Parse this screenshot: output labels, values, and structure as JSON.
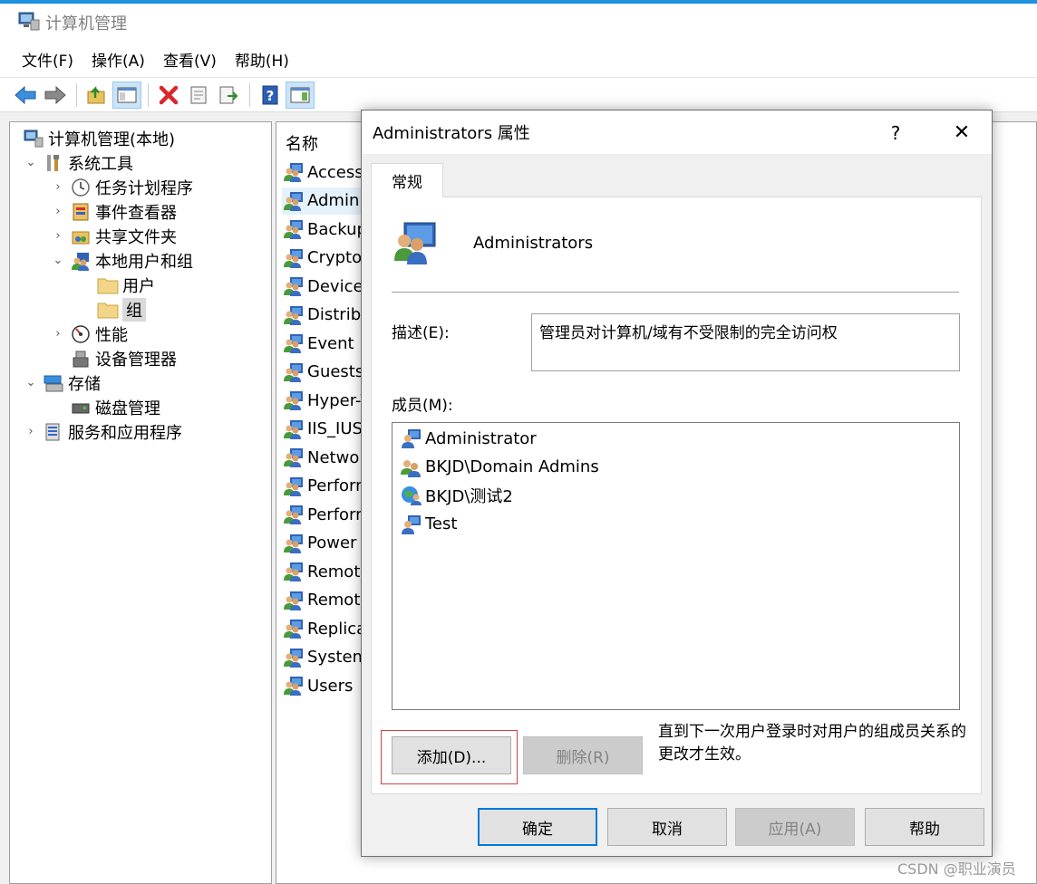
{
  "window": {
    "title": "计算机管理",
    "menu": [
      "文件(F)",
      "操作(A)",
      "查看(V)",
      "帮助(H)"
    ]
  },
  "toolbar": {
    "icons": [
      "back-arrow-icon",
      "forward-arrow-icon",
      "up-folder-icon",
      "show-hide-tree-icon",
      "delete-icon",
      "properties-icon",
      "export-list-icon",
      "help-icon",
      "action-pane-icon"
    ]
  },
  "tree": {
    "items": [
      {
        "label": "计算机管理(本地)",
        "icon": "computer-management-icon",
        "level": 0,
        "chevron": ""
      },
      {
        "label": "系统工具",
        "icon": "tools-icon",
        "level": 1,
        "chevron": "expanded"
      },
      {
        "label": "任务计划程序",
        "icon": "clock-icon",
        "level": 2,
        "chevron": "collapsed"
      },
      {
        "label": "事件查看器",
        "icon": "event-viewer-icon",
        "level": 2,
        "chevron": "collapsed"
      },
      {
        "label": "共享文件夹",
        "icon": "shared-folder-icon",
        "level": 2,
        "chevron": "collapsed"
      },
      {
        "label": "本地用户和组",
        "icon": "users-groups-icon",
        "level": 2,
        "chevron": "expanded"
      },
      {
        "label": "用户",
        "icon": "folder-icon",
        "level": 3,
        "chevron": ""
      },
      {
        "label": "组",
        "icon": "folder-icon",
        "level": 3,
        "chevron": "",
        "selected": true
      },
      {
        "label": "性能",
        "icon": "performance-icon",
        "level": 2,
        "chevron": "collapsed"
      },
      {
        "label": "设备管理器",
        "icon": "device-manager-icon",
        "level": 2,
        "chevron": ""
      },
      {
        "label": "存储",
        "icon": "storage-icon",
        "level": 1,
        "chevron": "expanded"
      },
      {
        "label": "磁盘管理",
        "icon": "disk-icon",
        "level": 2,
        "chevron": ""
      },
      {
        "label": "服务和应用程序",
        "icon": "services-icon",
        "level": 1,
        "chevron": "collapsed"
      }
    ]
  },
  "list": {
    "header": "名称",
    "rows": [
      {
        "label": "Access"
      },
      {
        "label": "Admini",
        "selected": true
      },
      {
        "label": "Backup"
      },
      {
        "label": "Cryptog"
      },
      {
        "label": "Device"
      },
      {
        "label": "Distribu"
      },
      {
        "label": "Event L"
      },
      {
        "label": "Guests"
      },
      {
        "label": "Hyper-V"
      },
      {
        "label": "IIS_IUSI"
      },
      {
        "label": "Networ"
      },
      {
        "label": "Perform"
      },
      {
        "label": "Perform"
      },
      {
        "label": "Power U"
      },
      {
        "label": "Remote"
      },
      {
        "label": "Remote"
      },
      {
        "label": "Replica"
      },
      {
        "label": "System"
      },
      {
        "label": "Users"
      }
    ]
  },
  "dialog": {
    "title": "Administrators 属性",
    "help_glyph": "?",
    "close_glyph": "✕",
    "tab": "常规",
    "group_name": "Administrators",
    "description_label": "描述(E):",
    "description_value": "管理员对计算机/域有不受限制的完全访问权",
    "members_label": "成员(M):",
    "members": [
      {
        "label": "Administrator",
        "icon": "user-icon"
      },
      {
        "label": "BKJD\\Domain Admins",
        "icon": "group-icon"
      },
      {
        "label": "BKJD\\测试2",
        "icon": "domain-user-icon"
      },
      {
        "label": "Test",
        "icon": "user-icon"
      }
    ],
    "add_button": "添加(D)...",
    "remove_button": "删除(R)",
    "note": "直到下一次用户登录时对用户的组成员关系的更改才生效。",
    "ok_button": "确定",
    "cancel_button": "取消",
    "apply_button": "应用(A)",
    "help_button": "帮助"
  },
  "watermark": "CSDN @职业演员",
  "colors": {
    "accent": "#0078d7",
    "selection": "#e5f1fb",
    "highlight_border": "#d04040"
  }
}
